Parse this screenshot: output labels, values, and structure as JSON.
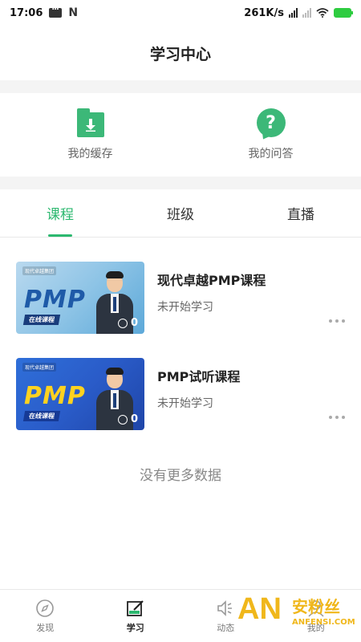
{
  "status_bar": {
    "time": "17:06",
    "speed": "261K/s",
    "icons": [
      "message-icon",
      "n-icon",
      "signal-icon",
      "wifi-icon",
      "battery-icon"
    ]
  },
  "header": {
    "title": "学习中心"
  },
  "quick_actions": [
    {
      "label": "我的缓存",
      "icon": "download-folder-icon"
    },
    {
      "label": "我的问答",
      "icon": "question-bubble-icon"
    }
  ],
  "tabs": [
    {
      "label": "课程",
      "active": true
    },
    {
      "label": "班级",
      "active": false
    },
    {
      "label": "直播",
      "active": false
    }
  ],
  "courses": [
    {
      "title": "现代卓越PMP课程",
      "status": "未开始学习",
      "thumb_text": "PMP",
      "thumb_badge": "在线课程",
      "thumb_brand": "现代卓越集团",
      "learners": "0"
    },
    {
      "title": "PMP试听课程",
      "status": "未开始学习",
      "thumb_text": "PMP",
      "thumb_badge": "在线课程",
      "thumb_brand": "现代卓越集团",
      "learners": "0"
    }
  ],
  "no_more_text": "没有更多数据",
  "bottom_nav": [
    {
      "label": "发现",
      "icon": "compass-icon",
      "active": false
    },
    {
      "label": "学习",
      "icon": "study-icon",
      "active": true
    },
    {
      "label": "动态",
      "icon": "speaker-icon",
      "active": false
    },
    {
      "label": "我的",
      "icon": "profile-icon",
      "active": false
    }
  ],
  "watermark": {
    "letters": "AN",
    "text": "安粉丝",
    "url": "ANFENSI.COM"
  },
  "colors": {
    "accent": "#2cb86f",
    "icon_green": "#3cb878",
    "watermark": "#f0b71b"
  }
}
